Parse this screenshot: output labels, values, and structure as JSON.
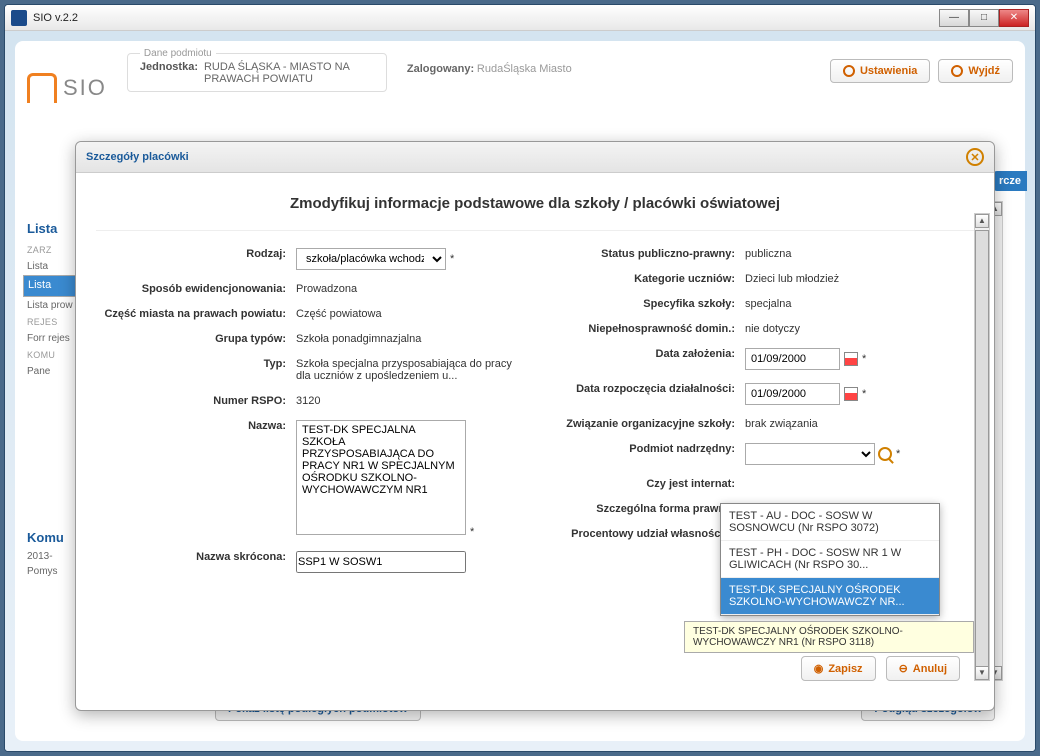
{
  "window": {
    "title": "SIO v.2.2"
  },
  "header": {
    "dane_title": "Dane podmiotu",
    "jednostka_label": "Jednostka:",
    "jednostka_value": "RUDA ŚLĄSKA - MIASTO NA PRAWACH POWIATU",
    "login_label": "Zalogowany:",
    "login_value": "RudaŚląska Miasto",
    "ustawienia": "Ustawienia",
    "wyjdz": "Wyjdź",
    "logo": "SIO"
  },
  "left": {
    "lista": "Lista",
    "items": [
      "ZARZ",
      "Lista",
      "Lista",
      "Lista prow",
      "REJES",
      "Forr rejes",
      "KOMU",
      "Pane"
    ],
    "komunikaty": "Komu",
    "kom_date": "2013-",
    "kom_txt": "Pomys"
  },
  "modal": {
    "title": "Szczegóły placówki",
    "heading": "Zmodyfikuj informacje podstawowe dla szkoły / placówki oświatowej",
    "left": [
      {
        "l": "Rodzaj:",
        "t": "select",
        "v": "szkoła/placówka  wchodząc"
      },
      {
        "l": "Sposób ewidencjonowania:",
        "t": "text",
        "v": "Prowadzona"
      },
      {
        "l": "Część miasta na prawach powiatu:",
        "t": "text",
        "v": "Część powiatowa"
      },
      {
        "l": "Grupa typów:",
        "t": "text",
        "v": "Szkoła ponadgimnazjalna"
      },
      {
        "l": "Typ:",
        "t": "text",
        "v": "Szkoła specjalna przysposabiająca do pracy dla uczniów z upośledzeniem u..."
      },
      {
        "l": "Numer RSPO:",
        "t": "text",
        "v": "3120"
      },
      {
        "l": "Nazwa:",
        "t": "textarea",
        "v": "TEST-DK SPECJALNA SZKOŁA PRZYSPOSABIAJĄCA DO PRACY NR1 W SPECJALNYM OŚRODKU SZKOLNO-WYCHOWAWCZYM NR1"
      },
      {
        "l": "Nazwa skrócona:",
        "t": "input2",
        "v": "SSP1 W SOSW1"
      }
    ],
    "right": [
      {
        "l": "Status publiczno-prawny:",
        "t": "text",
        "v": "publiczna"
      },
      {
        "l": "Kategorie uczniów:",
        "t": "text",
        "v": "Dzieci lub młodzież"
      },
      {
        "l": "Specyfika szkoły:",
        "t": "text",
        "v": "specjalna"
      },
      {
        "l": "Niepełnosprawność domin.:",
        "t": "text",
        "v": "nie dotyczy"
      },
      {
        "l": "Data założenia:",
        "t": "date",
        "v": "01/09/2000"
      },
      {
        "l": "Data rozpoczęcia działalności:",
        "t": "date",
        "v": "01/09/2000"
      },
      {
        "l": "Związanie organizacyjne szkoły:",
        "t": "text",
        "v": "brak związania"
      },
      {
        "l": "Podmiot nadrzędny:",
        "t": "combo",
        "v": ""
      },
      {
        "l": "Czy jest internat:",
        "t": "text",
        "v": ""
      },
      {
        "l": "Szczególna forma prawna:",
        "t": "text",
        "v": ""
      },
      {
        "l": "Procentowy udział własności w",
        "t": "text",
        "v": ""
      }
    ],
    "dropdown": [
      "TEST - AU - DOC - SOSW W SOSNOWCU (Nr RSPO 3072)",
      "TEST - PH - DOC - SOSW NR 1 W GLIWICACH (Nr RSPO 30...",
      "TEST-DK SPECJALNY OŚRODEK SZKOLNO-WYCHOWAWCZY NR..."
    ],
    "tooltip": "TEST-DK SPECJALNY OŚRODEK SZKOLNO-WYCHOWAWCZY NR1 (Nr RSPO 3118)",
    "zapisz": "Zapisz",
    "anuluj": "Anuluj"
  },
  "footer": {
    "pokaz": "Pokaż listę podległych podmiotów",
    "podglad": "Podgląd szczegółów"
  },
  "rcze": "rcze"
}
